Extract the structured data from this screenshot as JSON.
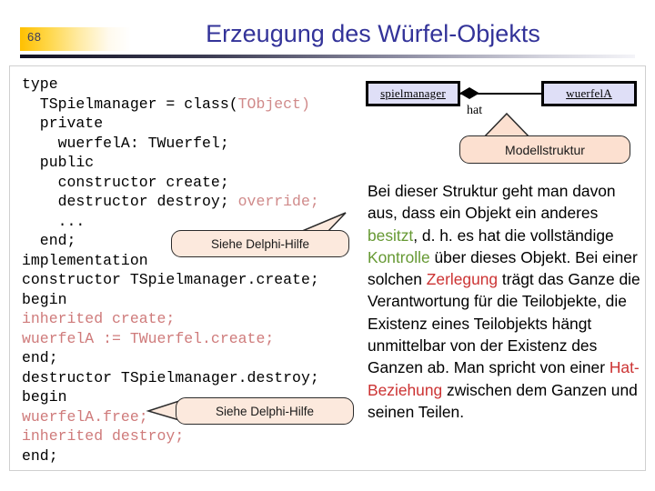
{
  "header": {
    "page_number": "68",
    "title": "Erzeugung des Würfel-Objekts",
    "title_color": "#333399",
    "accent_color": "#ffc000"
  },
  "code": {
    "language": "Object Pascal (Delphi)",
    "keyword_color": "#cf7b7b",
    "lines": [
      {
        "id": "l1",
        "text": "type"
      },
      {
        "id": "l2",
        "text": "  TSpielmanager = class(",
        "tail": "TObject)",
        "tail_style": "red"
      },
      {
        "id": "l3",
        "text": "  private"
      },
      {
        "id": "l4",
        "text": "    wuerfelA: TWuerfel;"
      },
      {
        "id": "l5",
        "text": "  public"
      },
      {
        "id": "l6",
        "text": "    constructor create;"
      },
      {
        "id": "l7",
        "text": "    destructor destroy; ",
        "tail": "override;",
        "tail_style": "red"
      },
      {
        "id": "l8",
        "text": "    ..."
      },
      {
        "id": "l9",
        "text": "  end;"
      },
      {
        "id": "l10",
        "text": "implementation"
      },
      {
        "id": "l11",
        "text": "constructor TSpielmanager.create;"
      },
      {
        "id": "l12",
        "text": "begin"
      },
      {
        "id": "l13",
        "text": "inherited create;",
        "style": "red"
      },
      {
        "id": "l14",
        "text": "wuerfelA := TWuerfel.create;",
        "style": "red"
      },
      {
        "id": "l15",
        "text": "end;"
      },
      {
        "id": "l16",
        "text": "destructor TSpielmanager.destroy;"
      },
      {
        "id": "l17",
        "text": "begin"
      },
      {
        "id": "l18",
        "text": "wuerfelA.free;",
        "style": "red"
      },
      {
        "id": "l19",
        "text": "inherited destroy;",
        "style": "red"
      },
      {
        "id": "l20",
        "text": "end;"
      }
    ]
  },
  "callouts": {
    "delphi_help_1": "Siehe Delphi-Hilfe",
    "delphi_help_2": "Siehe Delphi-Hilfe",
    "modellstruktur": "Modellstruktur",
    "fill_color": "#fce9dd",
    "border_color": "#2b2b2b"
  },
  "diagram": {
    "box_fill": "#dfdff7",
    "left_object": "spielmanager",
    "right_object": "wuerfelA",
    "association_label": "hat",
    "association_kind": "composition-filled-diamond"
  },
  "prose": {
    "highlight_green": "#669933",
    "highlight_red": "#cc3333",
    "segments": [
      {
        "text": "Bei dieser Struktur geht man davon aus, dass ein Objekt ein anderes ",
        "style": "plain"
      },
      {
        "text": "besitzt",
        "style": "green"
      },
      {
        "text": ", d. h. es hat die vollständige ",
        "style": "plain"
      },
      {
        "text": "Kontrolle",
        "style": "green"
      },
      {
        "text": " über dieses Objekt. Bei einer solchen ",
        "style": "plain"
      },
      {
        "text": "Zerlegung",
        "style": "red"
      },
      {
        "text": " trägt das Ganze die Verantwortung für die Teilobjekte, die Existenz eines Teilobjekts hängt unmittelbar von der Existenz des Ganzen ab. Man spricht von einer ",
        "style": "plain"
      },
      {
        "text": "Hat-Beziehung",
        "style": "red"
      },
      {
        "text": " zwischen dem Ganzen und seinen Teilen.",
        "style": "plain"
      }
    ]
  }
}
